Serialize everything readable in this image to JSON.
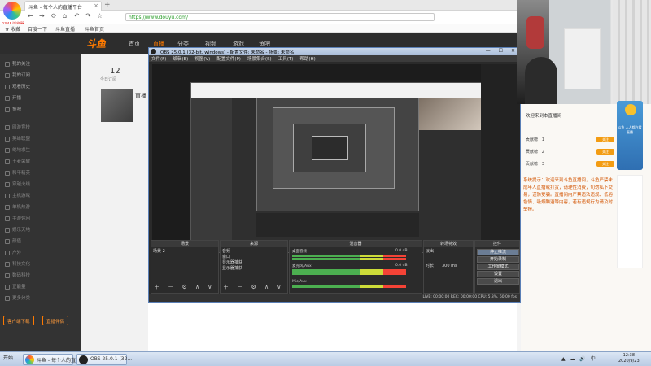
{
  "browser": {
    "tab_title": "斗鱼 - 每个人的直播平台",
    "logo_text": "2345浏览器",
    "address": "https://www.douyu.com/",
    "nav": {
      "back": "←",
      "forward": "→",
      "reload": "⟳",
      "home": "⌂",
      "undo": "↶",
      "redo": "↷",
      "star": "☆"
    },
    "bookmarks": [
      "★ 收藏",
      "百度一下",
      "斗鱼直播",
      "斗鱼首页"
    ]
  },
  "douyu": {
    "logo": "斗鱼",
    "nav": [
      "首页",
      "直播",
      "分类",
      "视频",
      "游戏",
      "鱼吧"
    ],
    "active_nav": "直播",
    "sidebar": [
      "我的关注",
      "我的订阅",
      "观看历史",
      "开播",
      "鱼吧",
      "网游竞技",
      "英雄联盟",
      "绝地求生",
      "王者荣耀",
      "和平精英",
      "穿越火线",
      "主机游戏",
      "单机热游",
      "手游休闲",
      "娱乐天地",
      "颜值",
      "户外",
      "科技文化",
      "数码科技",
      "正能量",
      "更多分类"
    ],
    "side_buttons": [
      "客户端下载",
      "直播伴侣"
    ],
    "stat_num": "12",
    "stat_label": "今日订阅",
    "thumb_text": "直播"
  },
  "obs": {
    "title": "OBS 25.0.1 (32-bit, windows) - 配置文件: 未命名 - 场景: 未命名",
    "window_buttons": "— ☐ ✕",
    "menu": [
      "文件(F)",
      "编辑(E)",
      "视图(V)",
      "配置文件(P)",
      "场景集合(S)",
      "工具(T)",
      "帮助(H)"
    ],
    "docks": {
      "scenes": {
        "title": "场景",
        "items": [
          "场景 2"
        ]
      },
      "sources": {
        "title": "来源",
        "items": [
          "音频",
          "窗口",
          "显示器捕获",
          "显示器捕获"
        ]
      },
      "mixer": {
        "title": "混音器",
        "tracks": [
          {
            "label": "桌面音频",
            "db": "0.0 dB"
          },
          {
            "label": "麦克风/Aux",
            "db": "0.0 dB"
          },
          {
            "label": "Mic/Aux",
            "db": "0.0 dB"
          }
        ]
      },
      "transitions": {
        "title": "转场特效",
        "type": "淡出",
        "duration_label": "时长",
        "duration": "300 ms"
      },
      "controls": {
        "title": "控件",
        "buttons": [
          "停止推流",
          "开始录制",
          "工作室模式",
          "设置",
          "退出"
        ]
      }
    },
    "status": "LIVE: 00:00:00   REC: 00:00:00   CPU: 5.8%, 60.00 fps",
    "ctrl_symbols": "＋ － ⚙ ∧ ∨"
  },
  "chat": {
    "header": "欢迎来到本直播间",
    "rows": [
      {
        "text": "贡献榜 · 1",
        "badge": "关注"
      },
      {
        "text": "贡献榜 · 2",
        "badge": "关注"
      },
      {
        "text": "贡献榜 · 3",
        "badge": "关注"
      }
    ],
    "message": "系统提示：欢迎来到斗鱼直播间，斗鱼严禁未成年人直播或打赏，请理性消费，切勿私下交易，谨防受骗。直播间内严禁违法违规、低俗色情、吸烟酗酒等内容，若有违规行为请及时举报。",
    "ad": "斗鱼 人人都在看 直播"
  },
  "taskbar": {
    "start": "开始",
    "tasks": [
      "斗鱼 - 每个人的直播平台",
      "OBS 25.0.1 (32..."
    ],
    "tray": "▲ ☁ 🔊 中",
    "time": "12:38",
    "date": "2020/9/23"
  }
}
